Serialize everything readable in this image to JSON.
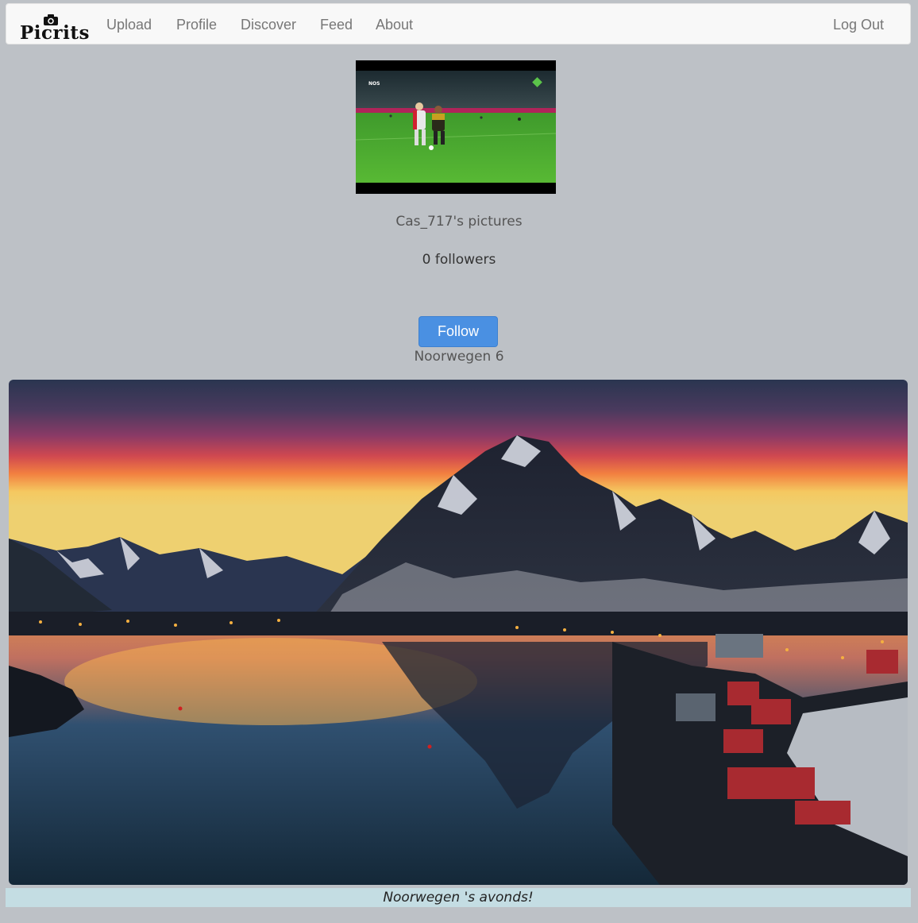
{
  "navbar": {
    "brand": "Picrits",
    "links": [
      "Upload",
      "Profile",
      "Discover",
      "Feed",
      "About"
    ],
    "logout": "Log Out"
  },
  "profile": {
    "pictures_title": "Cas_717's pictures",
    "followers": "0 followers",
    "follow_label": "Follow",
    "thumbnail_badge": "NOS"
  },
  "album": {
    "title": "Noorwegen 6",
    "caption": "Noorwegen 's avonds!"
  },
  "colors": {
    "background": "#bdc1c6",
    "navbar": "#f8f8f8",
    "button": "#4a90e2",
    "caption_bg": "#c4dde3"
  }
}
